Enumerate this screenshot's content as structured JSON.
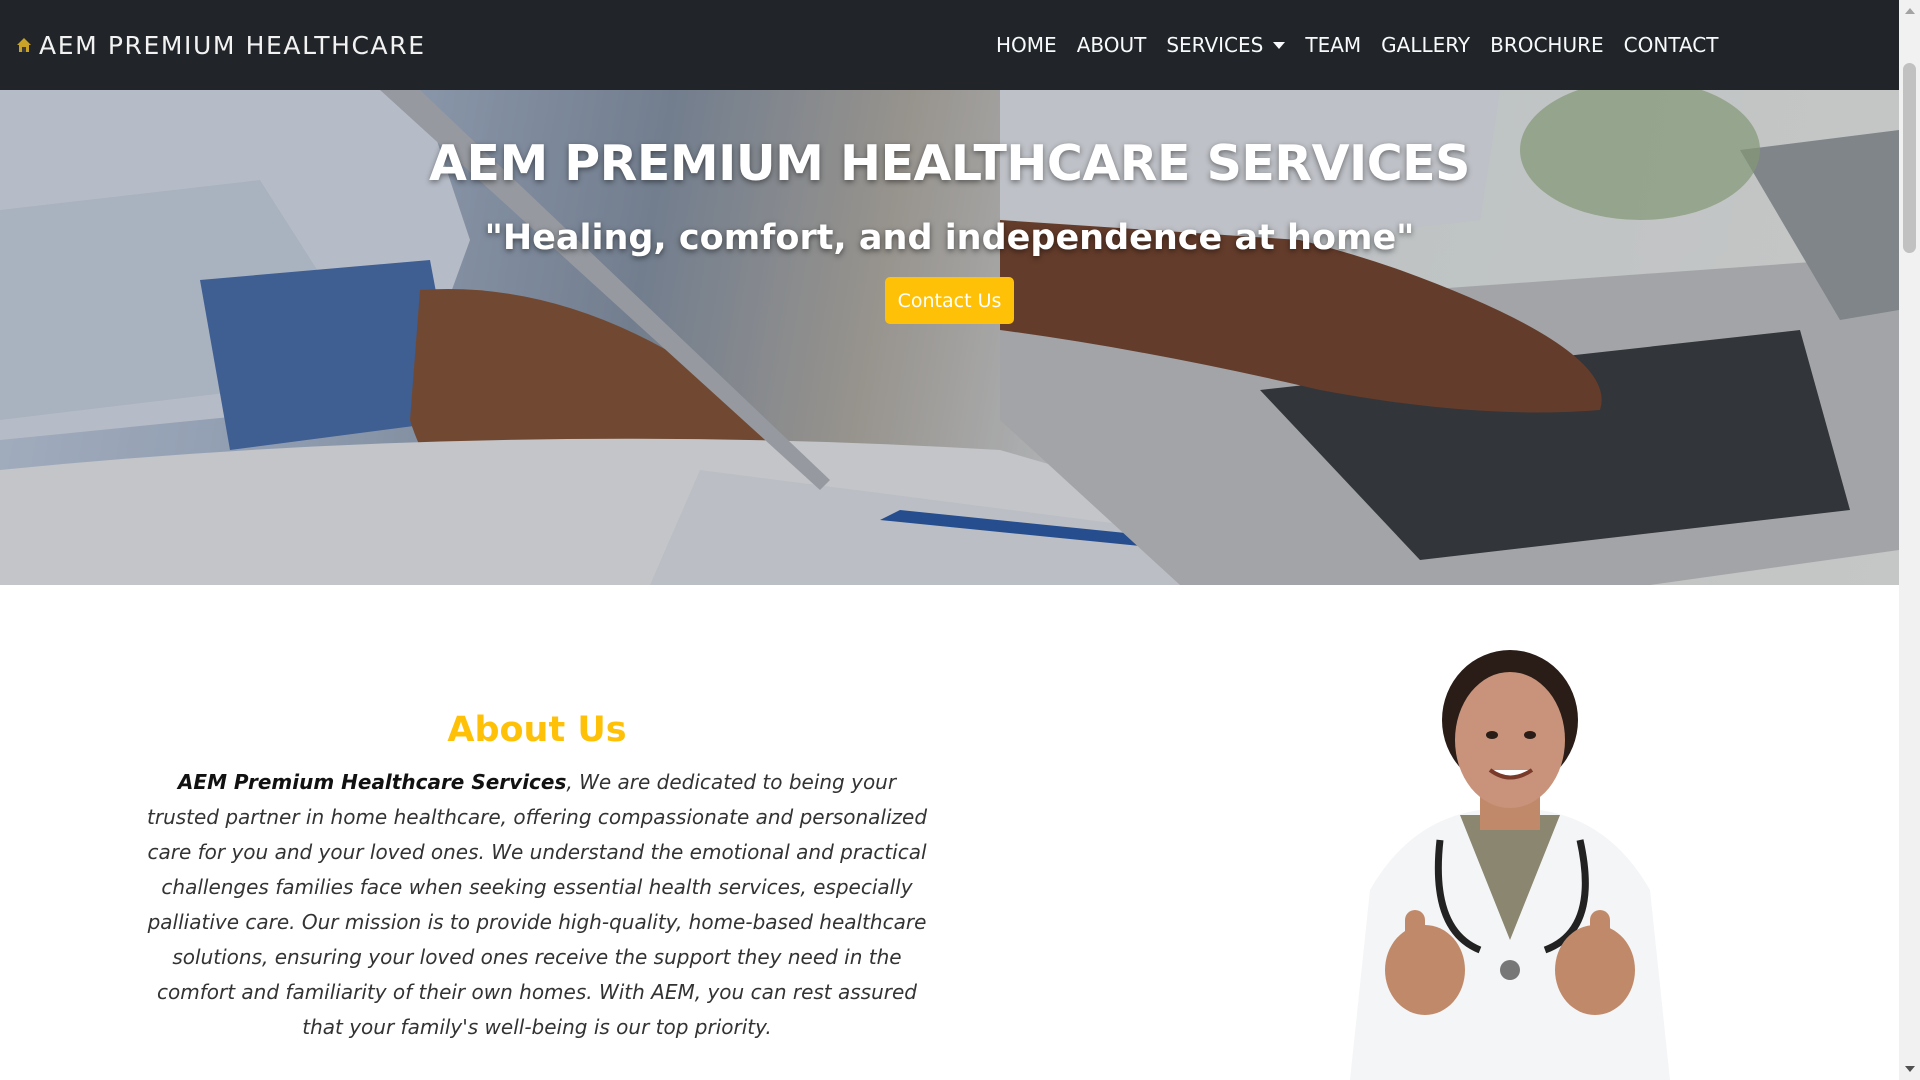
{
  "navbar": {
    "brand": "AEM PREMIUM HEALTHCARE",
    "logo_icon": "house-logo-icon",
    "links": [
      {
        "label": "HOME"
      },
      {
        "label": "ABOUT"
      },
      {
        "label": "SERVICES",
        "dropdown": true
      },
      {
        "label": "TEAM"
      },
      {
        "label": "GALLERY"
      },
      {
        "label": "BROCHURE"
      },
      {
        "label": "CONTACT"
      }
    ]
  },
  "hero": {
    "title": "AEM PREMIUM HEALTHCARE SERVICES",
    "subtitle": "\"Healing, comfort, and independence at home\"",
    "button_label": "Contact Us"
  },
  "about": {
    "title": "About Us",
    "company_name": "AEM Premium Healthcare Services",
    "body": ", We are dedicated to being your trusted partner in home healthcare, offering compassionate and personalized care for you and your loved ones. We understand the emotional and practical challenges families face when seeking essential health services, especially palliative care. Our mission is to provide high-quality, home-based healthcare solutions, ensuring your loved ones receive the support they need in the comfort and familiarity of their own homes. With AEM, you can rest assured that your family's well-being is our top priority."
  },
  "colors": {
    "navbar_bg": "#212529",
    "accent": "#ffc107",
    "hero_text": "#ffffff"
  }
}
